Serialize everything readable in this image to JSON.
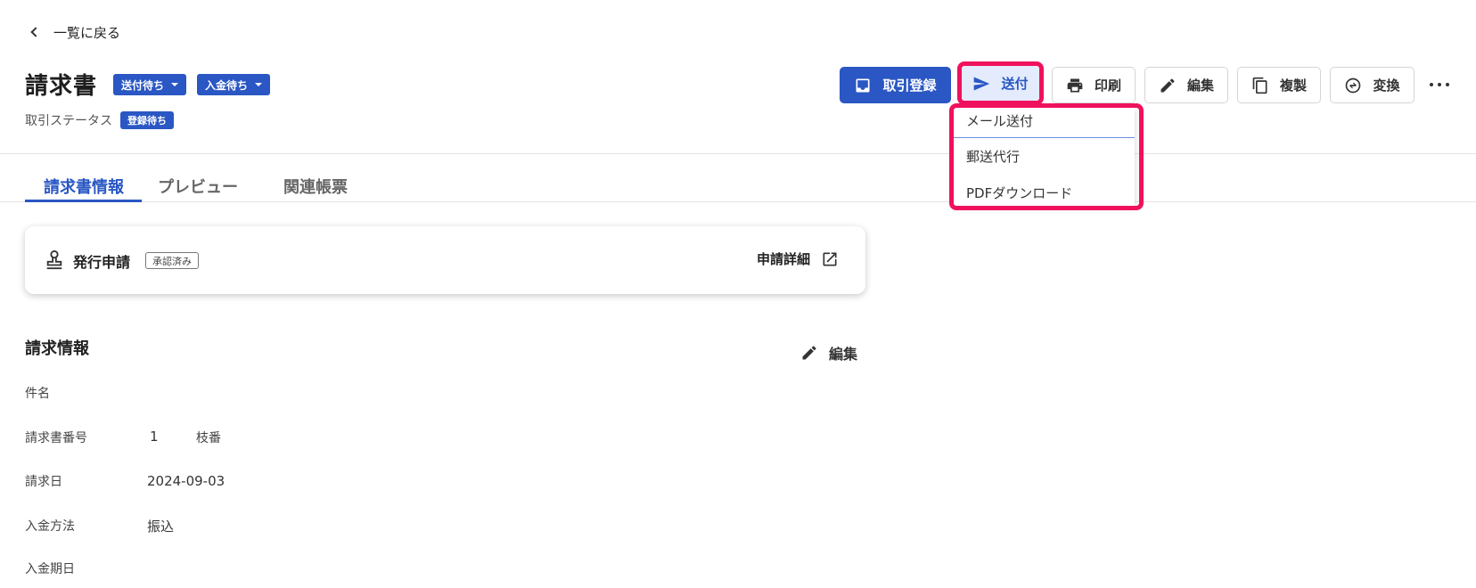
{
  "back": {
    "label": "一覧に戻る"
  },
  "header": {
    "title": "請求書",
    "badges": [
      "送付待ち",
      "入金待ち"
    ],
    "status_label": "取引ステータス",
    "status_badge": "登録待ち"
  },
  "toolbar": {
    "register": "取引登録",
    "send": "送付",
    "print": "印刷",
    "edit": "編集",
    "duplicate": "複製",
    "convert": "変換"
  },
  "send_menu": {
    "items": [
      "メール送付",
      "郵送代行",
      "PDFダウンロード"
    ]
  },
  "tabs": [
    "請求書情報",
    "プレビュー",
    "関連帳票"
  ],
  "issue_card": {
    "title": "発行申請",
    "tag": "承認済み",
    "link": "申請詳細"
  },
  "billing": {
    "title": "請求情報",
    "edit": "編集",
    "fields": {
      "subject_label": "件名",
      "number_label": "請求書番号",
      "number_value": "1",
      "branch_label": "枝番",
      "date_label": "請求日",
      "date_value": "2024-09-03",
      "method_label": "入金方法",
      "method_value": "振込",
      "due_label": "入金期日"
    }
  },
  "colors": {
    "primary": "#2a57c4",
    "highlight": "#f0115e",
    "send_bg": "#e3ebfc"
  }
}
